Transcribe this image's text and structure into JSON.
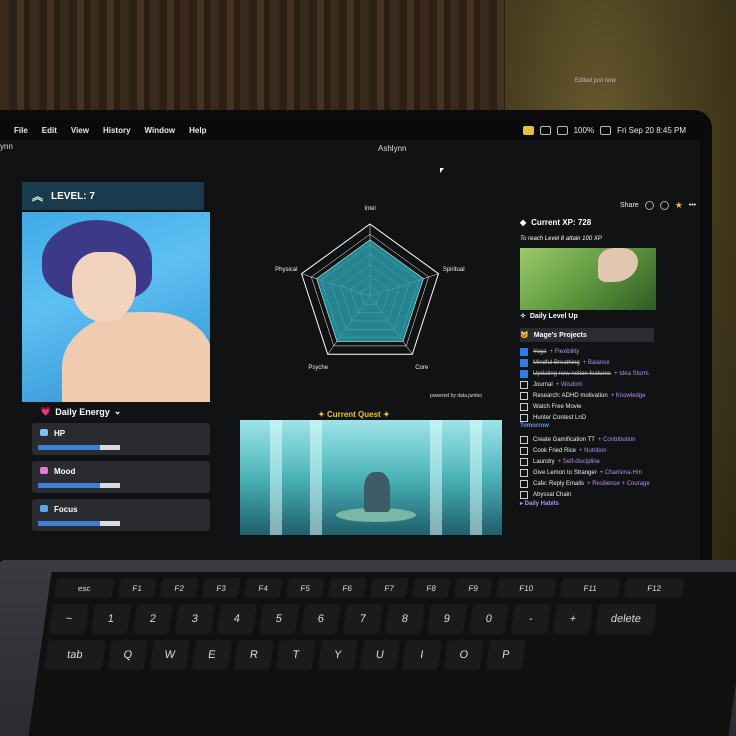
{
  "menubar": {
    "items": [
      "File",
      "Edit",
      "View",
      "History",
      "Window",
      "Help"
    ],
    "clock": "Fri Sep 20  8:45 PM",
    "battery": "100%"
  },
  "window": {
    "left_label": "ynn",
    "title": "Ashlynn"
  },
  "page_header": {
    "edited": "Edited just now",
    "share": "Share"
  },
  "level": {
    "label": "LEVEL: 7"
  },
  "energy": {
    "title": "Daily Energy"
  },
  "stats": [
    {
      "label": "HP",
      "value": 0.75,
      "color": "#7cc4f0"
    },
    {
      "label": "Mood",
      "value": 0.75,
      "color": "#e07cd2"
    },
    {
      "label": "Focus",
      "value": 0.75,
      "color": "#5aa7ea"
    }
  ],
  "radar": {
    "axes": [
      "Intel",
      "Spiritual",
      "Core",
      "Psyche",
      "Physical"
    ],
    "values": [
      0.78,
      0.78,
      0.78,
      0.78,
      0.78
    ],
    "powered_by": "powered by data.jumbo"
  },
  "quest": {
    "title": "Current Quest"
  },
  "xp": {
    "title": "Current XP: 728",
    "note": "To reach Level 8 attain 100 XP"
  },
  "daily_level_up": "Daily Level Up",
  "projects": {
    "title": "Mage's Projects",
    "today": [
      {
        "text": "Yoga",
        "tag": "Flexibility",
        "done": true
      },
      {
        "text": "Mindful Breathing",
        "tag": "Balance",
        "done": true
      },
      {
        "text": "Updating new notion features",
        "tag": "Idea Storm",
        "done": true
      },
      {
        "text": "Journal",
        "tag": "Wisdom",
        "done": false
      },
      {
        "text": "Research: ADHD motivation",
        "tag": "Knowledge",
        "done": false
      },
      {
        "text": "Watch Free Movie",
        "tag": "",
        "done": false
      },
      {
        "text": "Hunter Contest LnD",
        "tag": "",
        "done": false
      }
    ],
    "tomorrow_label": "Tomorrow",
    "tomorrow": [
      {
        "text": "Create Gamification TT",
        "tag": "Contribution",
        "done": false
      },
      {
        "text": "Cook Fried Rice",
        "tag": "Nutrition",
        "done": false
      },
      {
        "text": "Laundry",
        "tag": "Self-discipline",
        "done": false
      },
      {
        "text": "Give Lemon to Stranger",
        "tag": "Charisma-Hm",
        "done": false
      },
      {
        "text": "Cafe: Reply Emails",
        "tag": "Resilience + Courage",
        "done": false
      },
      {
        "text": "Abyssal Chain",
        "tag": "",
        "done": false
      }
    ],
    "daily_habits": "Daily Habits"
  },
  "keyboard": {
    "fn_row": [
      "esc",
      "F1",
      "F2",
      "F3",
      "F4",
      "F5",
      "F6",
      "F7",
      "F8",
      "F9",
      "F10",
      "F11",
      "F12"
    ],
    "num_row": [
      "~",
      "1",
      "2",
      "3",
      "4",
      "5",
      "6",
      "7",
      "8",
      "9",
      "0",
      "-",
      "+",
      "delete"
    ],
    "top_row": [
      "Q",
      "W",
      "E",
      "R",
      "T",
      "Y",
      "U",
      "I",
      "O",
      "P"
    ],
    "tab": "tab"
  }
}
